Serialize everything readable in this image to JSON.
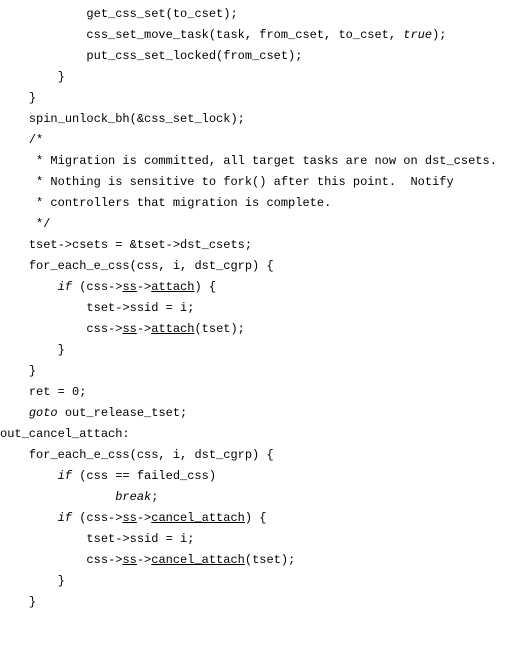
{
  "code": {
    "lines": [
      {
        "indent": 12,
        "segments": [
          {
            "t": "get_css_set(to_cset);"
          }
        ]
      },
      {
        "indent": 12,
        "segments": [
          {
            "t": "css_set_move_task(task, from_cset, to_cset, "
          },
          {
            "t": "true",
            "cls": "keyword"
          },
          {
            "t": ");"
          }
        ]
      },
      {
        "indent": 12,
        "segments": [
          {
            "t": "put_css_set_locked(from_cset);"
          }
        ]
      },
      {
        "indent": 8,
        "segments": [
          {
            "t": "}"
          }
        ]
      },
      {
        "indent": 4,
        "segments": [
          {
            "t": "}"
          }
        ]
      },
      {
        "indent": 4,
        "segments": [
          {
            "t": "spin_unlock_bh(&css_set_lock);"
          }
        ]
      },
      {
        "indent": 0,
        "segments": [
          {
            "t": ""
          }
        ]
      },
      {
        "indent": 4,
        "segments": [
          {
            "t": "/*"
          }
        ]
      },
      {
        "indent": 5,
        "segments": [
          {
            "t": "* Migration is committed, all target tasks are now on dst_csets."
          }
        ]
      },
      {
        "indent": 5,
        "segments": [
          {
            "t": "* Nothing is sensitive to fork() after this point.  Notify"
          }
        ]
      },
      {
        "indent": 5,
        "segments": [
          {
            "t": "* controllers that migration is complete."
          }
        ]
      },
      {
        "indent": 5,
        "segments": [
          {
            "t": "*/"
          }
        ]
      },
      {
        "indent": 4,
        "segments": [
          {
            "t": "tset->csets = &tset->dst_csets;"
          }
        ]
      },
      {
        "indent": 0,
        "segments": [
          {
            "t": ""
          }
        ]
      },
      {
        "indent": 4,
        "segments": [
          {
            "t": "for_each_e_css(css, i, dst_cgrp) {"
          }
        ]
      },
      {
        "indent": 8,
        "segments": [
          {
            "t": "if",
            "cls": "keyword"
          },
          {
            "t": " (css->"
          },
          {
            "t": "ss",
            "cls": "underline"
          },
          {
            "t": "->"
          },
          {
            "t": "attach",
            "cls": "underline"
          },
          {
            "t": ") {"
          }
        ]
      },
      {
        "indent": 12,
        "segments": [
          {
            "t": "tset->ssid = i;"
          }
        ]
      },
      {
        "indent": 12,
        "segments": [
          {
            "t": "css->"
          },
          {
            "t": "ss",
            "cls": "underline"
          },
          {
            "t": "->"
          },
          {
            "t": "attach",
            "cls": "underline"
          },
          {
            "t": "(tset);"
          }
        ]
      },
      {
        "indent": 8,
        "segments": [
          {
            "t": "}"
          }
        ]
      },
      {
        "indent": 4,
        "segments": [
          {
            "t": "}"
          }
        ]
      },
      {
        "indent": 0,
        "segments": [
          {
            "t": ""
          }
        ]
      },
      {
        "indent": 4,
        "segments": [
          {
            "t": "ret = 0;"
          }
        ]
      },
      {
        "indent": 4,
        "segments": [
          {
            "t": "goto",
            "cls": "keyword"
          },
          {
            "t": " out_release_tset;"
          }
        ]
      },
      {
        "indent": 0,
        "segments": [
          {
            "t": ""
          }
        ]
      },
      {
        "indent": 0,
        "segments": [
          {
            "t": "out_cancel_attach:"
          }
        ]
      },
      {
        "indent": 4,
        "segments": [
          {
            "t": "for_each_e_css(css, i, dst_cgrp) {"
          }
        ]
      },
      {
        "indent": 8,
        "segments": [
          {
            "t": "if",
            "cls": "keyword"
          },
          {
            "t": " (css == failed_css)"
          }
        ]
      },
      {
        "indent": 16,
        "segments": [
          {
            "t": "break",
            "cls": "keyword"
          },
          {
            "t": ";"
          }
        ]
      },
      {
        "indent": 8,
        "segments": [
          {
            "t": "if",
            "cls": "keyword"
          },
          {
            "t": " (css->"
          },
          {
            "t": "ss",
            "cls": "underline"
          },
          {
            "t": "->"
          },
          {
            "t": "cancel_attach",
            "cls": "underline"
          },
          {
            "t": ") {"
          }
        ]
      },
      {
        "indent": 12,
        "segments": [
          {
            "t": "tset->ssid = i;"
          }
        ]
      },
      {
        "indent": 12,
        "segments": [
          {
            "t": "css->"
          },
          {
            "t": "ss",
            "cls": "underline"
          },
          {
            "t": "->"
          },
          {
            "t": "cancel_attach",
            "cls": "underline"
          },
          {
            "t": "(tset);"
          }
        ]
      },
      {
        "indent": 8,
        "segments": [
          {
            "t": "}"
          }
        ]
      },
      {
        "indent": 4,
        "segments": [
          {
            "t": "}"
          }
        ]
      }
    ]
  }
}
